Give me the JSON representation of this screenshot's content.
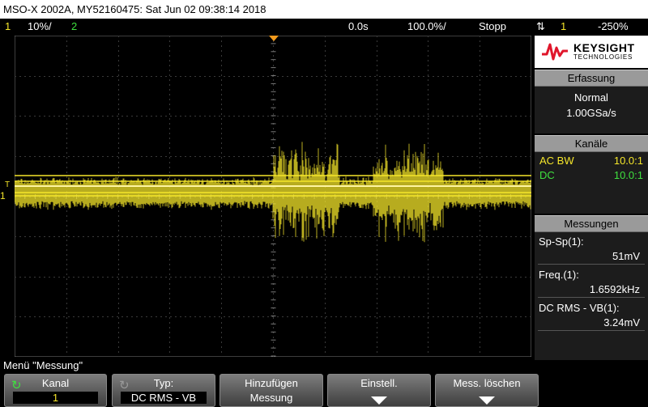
{
  "title": "MSO-X 2002A, MY52160475: Sat Jun 02 09:38:14 2018",
  "status": {
    "ch1_num": "1",
    "ch1_scale": "10%/",
    "ch2_num": "2",
    "time_delay": "0.0s",
    "time_scale": "100.0%/",
    "run_state": "Stopp",
    "trigger_source": "1",
    "trigger_level": "-250%"
  },
  "logo": {
    "brand": "KEYSIGHT",
    "sub": "TECHNOLOGIES"
  },
  "erfassung": {
    "header": "Erfassung",
    "mode": "Normal",
    "rate": "1.00GSa/s"
  },
  "kanaele": {
    "header": "Kanäle",
    "rows": [
      {
        "label": "AC BW",
        "value": "10.0:1",
        "color": "#f5e62a"
      },
      {
        "label": "DC",
        "value": "10.0:1",
        "color": "#3fe03f"
      }
    ]
  },
  "messungen": {
    "header": "Messungen",
    "items": [
      {
        "label": "Sp-Sp(1):",
        "value": "51mV"
      },
      {
        "label": "Freq.(1):",
        "value": "1.6592kHz"
      },
      {
        "label": "DC RMS - VB(1):",
        "value": "3.24mV"
      }
    ]
  },
  "menu_title": "Menü \"Messung\"",
  "softkeys": {
    "kanal_label": "Kanal",
    "kanal_value": "1",
    "typ_label": "Typ:",
    "typ_value": "DC RMS - VB",
    "add_label": "Hinzufügen",
    "add_value": "Messung",
    "settings_label": "Einstell.",
    "clear_label": "Mess. löschen"
  },
  "colors": {
    "ch1": "#f5e62a",
    "ch2": "#3fe03f",
    "panel_header": "#9a9a9a"
  },
  "markers": {
    "ch1_ground": "1",
    "trigger_marker": "T"
  }
}
